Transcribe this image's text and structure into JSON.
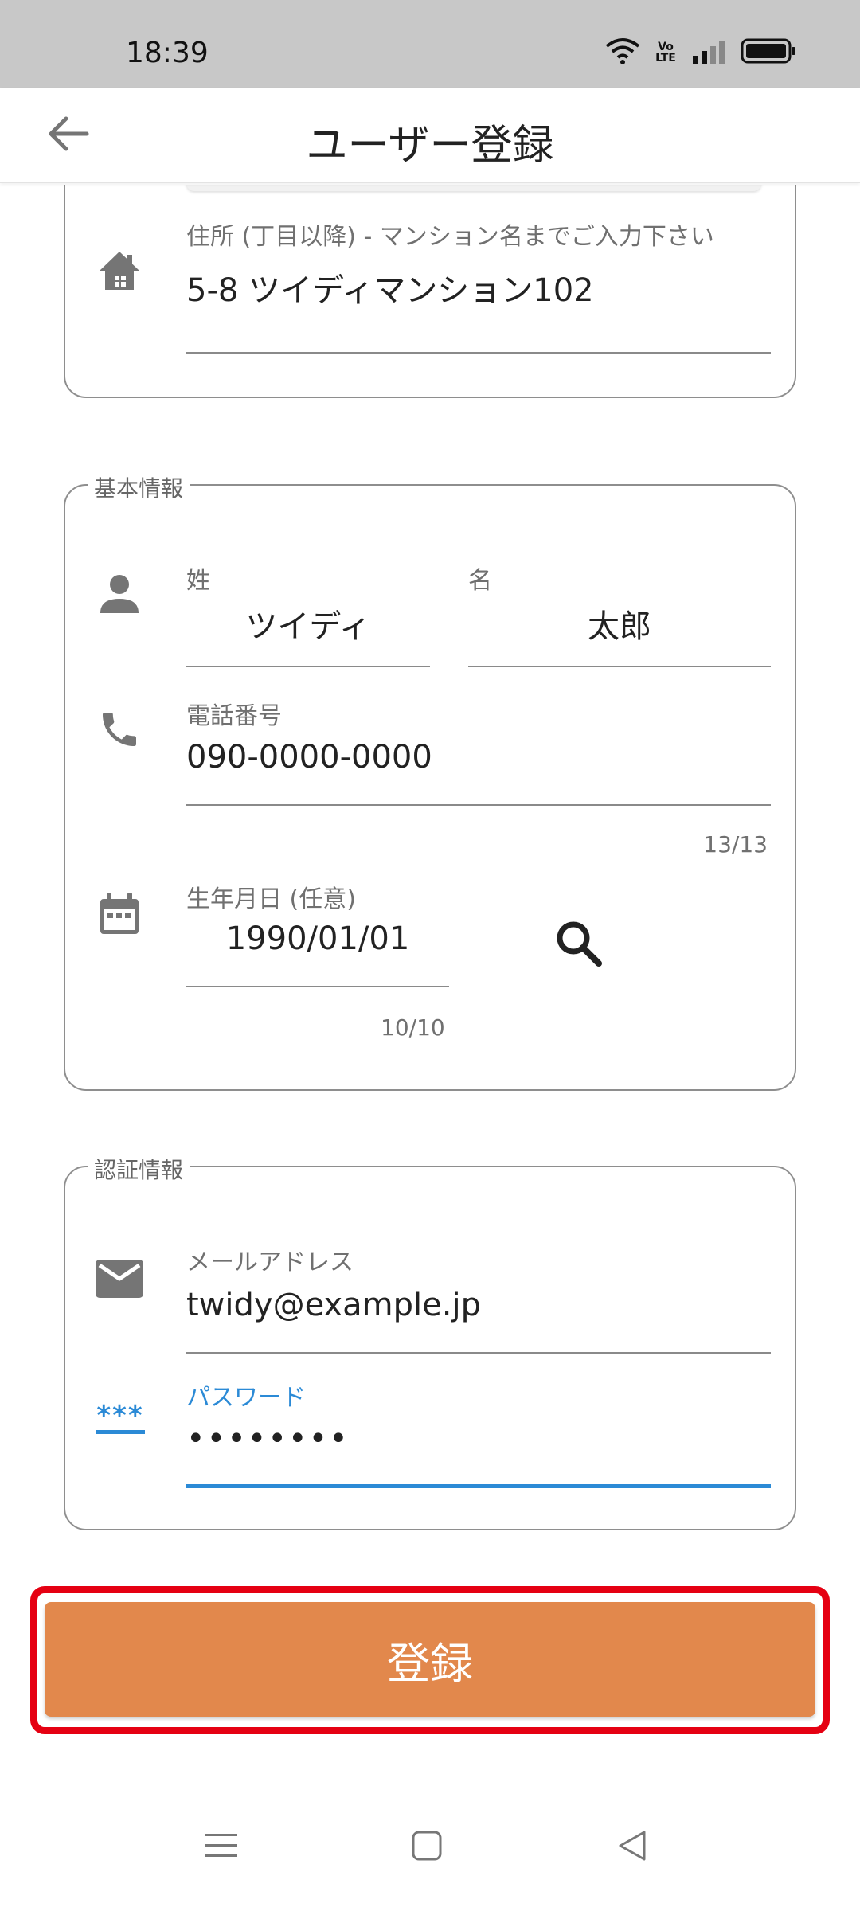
{
  "status_bar": {
    "time": "18:39",
    "volte_label": "Vo LTE"
  },
  "app_bar": {
    "title": "ユーザー登録"
  },
  "address_card": {
    "field_label": "住所 (丁目以降) - マンション名までご入力下さい",
    "field_value": "5-8 ツイディマンション102"
  },
  "basic_info": {
    "section_label": "基本情報",
    "last_name_label": "姓",
    "last_name_value": "ツイディ",
    "first_name_label": "名",
    "first_name_value": "太郎",
    "phone_label": "電話番号",
    "phone_value": "090-0000-0000",
    "phone_counter": "13/13",
    "birthday_label": "生年月日 (任意)",
    "birthday_value": "1990/01/01",
    "birthday_counter": "10/10"
  },
  "auth_info": {
    "section_label": "認証情報",
    "email_label": "メールアドレス",
    "email_value": "twidy@example.jp",
    "password_label": "パスワード",
    "password_value": "••••••••",
    "password_icon_text": "***"
  },
  "submit": {
    "label": "登録"
  },
  "colors": {
    "accent_blue": "#2b8ad6",
    "submit_orange": "#e2884c",
    "highlight_red": "#e50012"
  },
  "icons": [
    "back-arrow-icon",
    "home-icon",
    "person-icon",
    "phone-icon",
    "calendar-icon",
    "search-icon",
    "email-icon",
    "password-icon",
    "wifi-icon",
    "signal-icon",
    "battery-icon",
    "menu-icon",
    "home-square-icon",
    "back-triangle-icon"
  ]
}
